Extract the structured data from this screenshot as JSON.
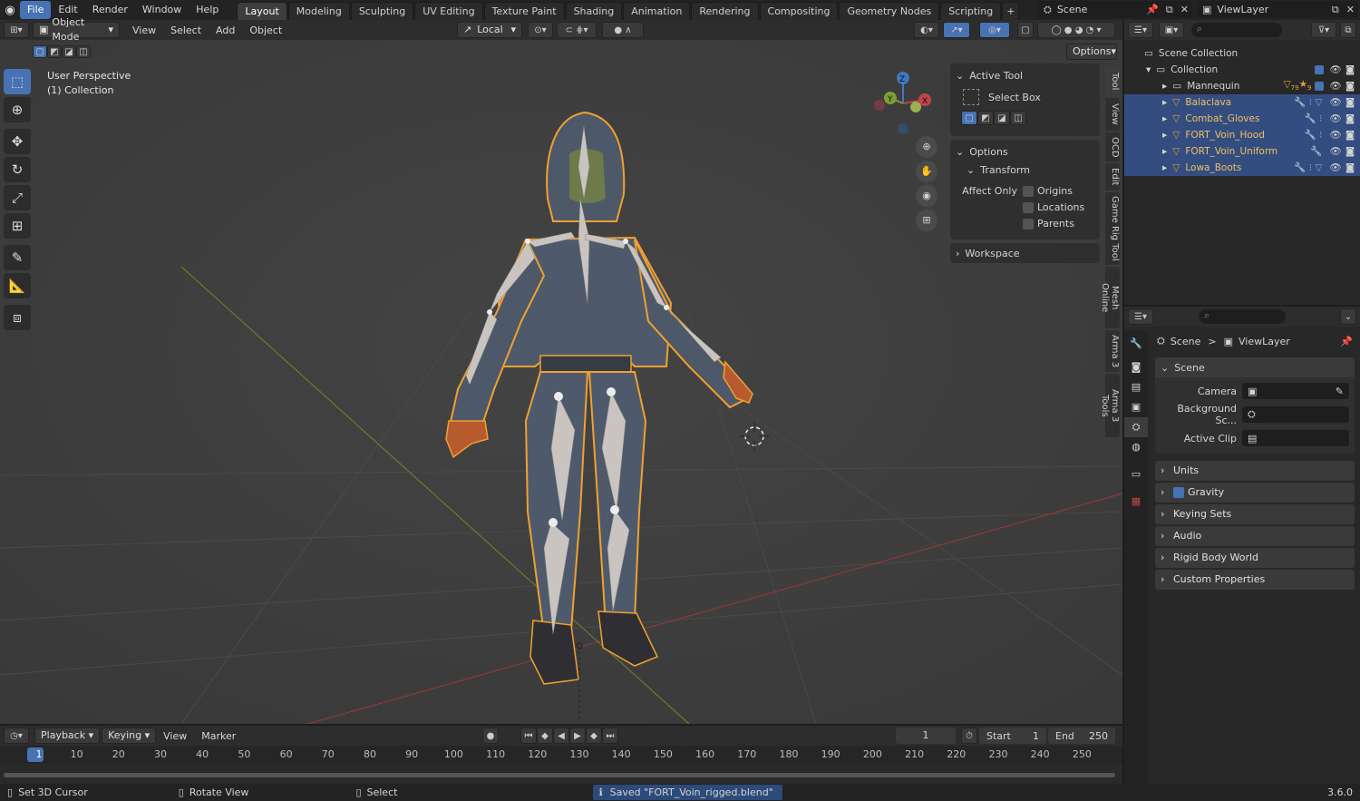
{
  "topbar": {
    "menus": [
      "File",
      "Edit",
      "Render",
      "Window",
      "Help"
    ],
    "workspaces": [
      "Layout",
      "Modeling",
      "Sculpting",
      "UV Editing",
      "Texture Paint",
      "Shading",
      "Animation",
      "Rendering",
      "Compositing",
      "Geometry Nodes",
      "Scripting"
    ],
    "add_tab": "+",
    "scene": "Scene",
    "view_layer": "ViewLayer"
  },
  "viewport_header": {
    "mode": "Object Mode",
    "menus": [
      "View",
      "Select",
      "Add",
      "Object"
    ],
    "orientation": "Local",
    "options": "Options"
  },
  "viewport": {
    "perspective": "User Perspective",
    "collection": "(1) Collection",
    "gizmo": {
      "x": "X",
      "y": "Y",
      "z": "Z"
    }
  },
  "npanel": {
    "active_tool_title": "Active Tool",
    "tool_name": "Select Box",
    "options_title": "Options",
    "transform_title": "Transform",
    "affect_only": "Affect Only",
    "origins": "Origins",
    "locations": "Locations",
    "parents": "Parents",
    "workspace": "Workspace",
    "tabs": [
      "Tool",
      "View",
      "OCD",
      "Edit",
      "Game Rig Tool",
      "Mesh Online",
      "Arma 3",
      "Arma 3 Tools"
    ]
  },
  "outliner": {
    "scene_collection": "Scene Collection",
    "collection": "Collection",
    "items": [
      {
        "name": "Mannequin",
        "selected": false
      },
      {
        "name": "Balaclava",
        "selected": true
      },
      {
        "name": "Combat_Gloves",
        "selected": true
      },
      {
        "name": "FORT_Voin_Hood",
        "selected": true
      },
      {
        "name": "FORT_Voin_Uniform",
        "selected": true
      },
      {
        "name": "Lowa_Boots",
        "selected": true
      }
    ],
    "badge_79": "79",
    "badge_9": "9"
  },
  "properties": {
    "breadcrumb_scene": "Scene",
    "breadcrumb_sep": ">",
    "breadcrumb_viewlayer": "ViewLayer",
    "section": "Scene",
    "camera_label": "Camera",
    "background_label": "Background Sc...",
    "clip_label": "Active Clip",
    "sections": [
      "Units",
      "Gravity",
      "Keying Sets",
      "Audio",
      "Rigid Body World",
      "Custom Properties"
    ]
  },
  "timeline": {
    "menus": [
      "Playback",
      "Keying",
      "View",
      "Marker"
    ],
    "current_frame": "1",
    "start_label": "Start",
    "start": "1",
    "end_label": "End",
    "end": "250",
    "ruler": [
      "1",
      "10",
      "20",
      "30",
      "40",
      "50",
      "60",
      "70",
      "80",
      "90",
      "100",
      "110",
      "120",
      "130",
      "140",
      "150",
      "160",
      "170",
      "180",
      "190",
      "200",
      "210",
      "220",
      "230",
      "240",
      "250"
    ]
  },
  "statusbar": {
    "hint1": "Set 3D Cursor",
    "hint2": "Rotate View",
    "hint3": "Select",
    "message": "Saved \"FORT_Voin_rigged.blend\"",
    "version": "3.6.0"
  },
  "colors": {
    "accent": "#4772b3",
    "selection_orange": "#f0a030",
    "viewport_bg": "#3d3d3d"
  }
}
